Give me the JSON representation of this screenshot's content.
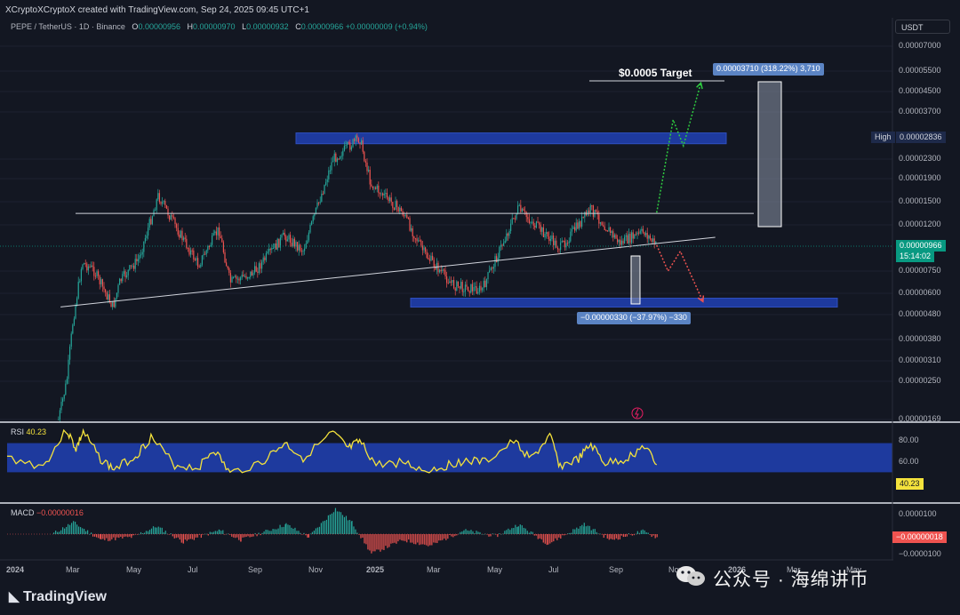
{
  "header": {
    "credit": "XCryptoXCryptoX created with TradingView.com, Sep 24, 2025 09:45 UTC+1",
    "symbol": "PEPE / TetherUS · 1D · Binance",
    "ohlc": [
      {
        "k": "O",
        "v": "0.00000956"
      },
      {
        "k": "H",
        "v": "0.00000970"
      },
      {
        "k": "L",
        "v": "0.00000932"
      },
      {
        "k": "C",
        "v": "0.00000966"
      }
    ],
    "change": "+0.00000009 (+0.94%)",
    "currency": "USDT"
  },
  "colors": {
    "background": "#131722",
    "up": "#26a69a",
    "down": "#ef5350",
    "zone": "#1e3a9e",
    "rsi_line": "#f4e23c",
    "projection_up": "#2ecc40",
    "projection_down": "#ef5350"
  },
  "price_axis": {
    "ticks": [
      "0.00007000",
      "0.00005500",
      "0.00004500",
      "0.00003700",
      "0.00002300",
      "0.00001900",
      "0.00001500",
      "0.00001200",
      "0.00000750",
      "0.00000600",
      "0.00000480",
      "0.00000380",
      "0.00000310",
      "0.00000250",
      "0.00000169"
    ],
    "high_label": "High",
    "high_value": "0.00002836",
    "last_value": "0.00000966",
    "countdown": "15:14:02"
  },
  "annotations": {
    "target_text": "$0.0005 Target",
    "measure_up": "0.00003710 (318.22%) 3,710",
    "measure_down": "−0.00000330 (−37.97%) −330"
  },
  "rsi": {
    "label": "RSI",
    "value": "40.23",
    "ticks": [
      "80.00",
      "60.00"
    ],
    "value_tag": "40.23"
  },
  "macd": {
    "label": "MACD",
    "value": "−0.00000016",
    "ticks": [
      "0.0000100",
      "−0.0000100"
    ],
    "value_tag": "−0.00000018"
  },
  "time_axis": [
    "2024",
    "Mar",
    "May",
    "Jul",
    "Sep",
    "Nov",
    "2025",
    "Mar",
    "May",
    "Jul",
    "Sep",
    "Nov",
    "2026",
    "Mar",
    "May"
  ],
  "footer": {
    "brand": "TradingView"
  },
  "watermark": {
    "text": "公众号 · 海绵讲币"
  },
  "chart_data": {
    "type": "candlestick",
    "title": "PEPE / TetherUS · 1D · Binance",
    "x_range": [
      "2024-01",
      "2026-05"
    ],
    "y_scale": "log",
    "ylim": [
      1.69e-06,
      7e-06
    ],
    "close_series": [
      {
        "x": "2024-02-20",
        "y": 1.2e-06
      },
      {
        "x": "2024-02-28",
        "y": 2.5e-06
      },
      {
        "x": "2024-03-05",
        "y": 4.5e-06
      },
      {
        "x": "2024-03-14",
        "y": 8.2e-06
      },
      {
        "x": "2024-03-25",
        "y": 7.6e-06
      },
      {
        "x": "2024-04-13",
        "y": 5.2e-06
      },
      {
        "x": "2024-04-20",
        "y": 6.8e-06
      },
      {
        "x": "2024-05-08",
        "y": 8.5e-06
      },
      {
        "x": "2024-05-27",
        "y": 1.6e-05
      },
      {
        "x": "2024-06-12",
        "y": 1.2e-05
      },
      {
        "x": "2024-07-05",
        "y": 8e-06
      },
      {
        "x": "2024-07-25",
        "y": 1.15e-05
      },
      {
        "x": "2024-08-05",
        "y": 6.7e-06
      },
      {
        "x": "2024-08-28",
        "y": 7.4e-06
      },
      {
        "x": "2024-09-27",
        "y": 1.08e-05
      },
      {
        "x": "2024-10-15",
        "y": 9.3e-06
      },
      {
        "x": "2024-11-13",
        "y": 2.3e-05
      },
      {
        "x": "2024-12-09",
        "y": 2.8e-05
      },
      {
        "x": "2024-12-20",
        "y": 1.8e-05
      },
      {
        "x": "2025-01-20",
        "y": 1.35e-05
      },
      {
        "x": "2025-02-10",
        "y": 9e-06
      },
      {
        "x": "2025-03-10",
        "y": 6.5e-06
      },
      {
        "x": "2025-04-07",
        "y": 6.2e-06
      },
      {
        "x": "2025-05-12",
        "y": 1.4e-05
      },
      {
        "x": "2025-06-22",
        "y": 9.5e-06
      },
      {
        "x": "2025-07-22",
        "y": 1.4e-05
      },
      {
        "x": "2025-08-19",
        "y": 1e-05
      },
      {
        "x": "2025-09-12",
        "y": 1.12e-05
      },
      {
        "x": "2025-09-24",
        "y": 9.66e-06
      }
    ],
    "zones": [
      {
        "from": 2.65e-05,
        "to": 2.95e-05
      },
      {
        "from": 5.2e-06,
        "to": 5.7e-06
      }
    ],
    "horizontal_line": 1.34e-05,
    "trendline": [
      {
        "x": "2024-02-22",
        "y": 5.2e-06
      },
      {
        "x": "2025-11-20",
        "y": 1.06e-05
      }
    ],
    "target_line": 5e-05,
    "projection_up": [
      {
        "x": "2025-09-24",
        "y": 1.35e-05
      },
      {
        "x": "2025-10-10",
        "y": 3.4e-05
      },
      {
        "x": "2025-10-20",
        "y": 2.6e-05
      },
      {
        "x": "2025-11-06",
        "y": 4.9e-05
      }
    ],
    "projection_down": [
      {
        "x": "2025-09-24",
        "y": 9.8e-06
      },
      {
        "x": "2025-10-05",
        "y": 7.5e-06
      },
      {
        "x": "2025-10-17",
        "y": 9.2e-06
      },
      {
        "x": "2025-11-08",
        "y": 5.5e-06
      }
    ],
    "rsi": {
      "range": [
        0,
        100
      ],
      "band": [
        30,
        70
      ],
      "series": [
        {
          "x": "2024-01-01",
          "y": 50
        },
        {
          "x": "2024-02-05",
          "y": 38
        },
        {
          "x": "2024-02-28",
          "y": 88
        },
        {
          "x": "2024-03-08",
          "y": 62
        },
        {
          "x": "2024-03-15",
          "y": 85
        },
        {
          "x": "2024-04-01",
          "y": 48
        },
        {
          "x": "2024-04-14",
          "y": 34
        },
        {
          "x": "2024-05-05",
          "y": 52
        },
        {
          "x": "2024-05-20",
          "y": 78
        },
        {
          "x": "2024-06-12",
          "y": 40
        },
        {
          "x": "2024-07-05",
          "y": 36
        },
        {
          "x": "2024-07-20",
          "y": 62
        },
        {
          "x": "2024-08-05",
          "y": 28
        },
        {
          "x": "2024-09-05",
          "y": 44
        },
        {
          "x": "2024-09-27",
          "y": 70
        },
        {
          "x": "2024-10-15",
          "y": 50
        },
        {
          "x": "2024-11-13",
          "y": 84
        },
        {
          "x": "2024-11-28",
          "y": 62
        },
        {
          "x": "2024-12-09",
          "y": 72
        },
        {
          "x": "2024-12-25",
          "y": 40
        },
        {
          "x": "2025-01-20",
          "y": 44
        },
        {
          "x": "2025-02-10",
          "y": 32
        },
        {
          "x": "2025-03-01",
          "y": 38
        },
        {
          "x": "2025-03-20",
          "y": 46
        },
        {
          "x": "2025-04-10",
          "y": 44
        },
        {
          "x": "2025-05-08",
          "y": 72
        },
        {
          "x": "2025-05-25",
          "y": 48
        },
        {
          "x": "2025-06-12",
          "y": 80
        },
        {
          "x": "2025-06-22",
          "y": 38
        },
        {
          "x": "2025-07-10",
          "y": 48
        },
        {
          "x": "2025-07-22",
          "y": 68
        },
        {
          "x": "2025-08-05",
          "y": 42
        },
        {
          "x": "2025-08-25",
          "y": 48
        },
        {
          "x": "2025-09-12",
          "y": 66
        },
        {
          "x": "2025-09-24",
          "y": 40.23
        }
      ]
    },
    "macd": {
      "range": [
        -1e-06,
        1e-06
      ],
      "histogram": [
        {
          "x": "2024-02-15",
          "y": 5e-08
        },
        {
          "x": "2024-03-05",
          "y": 6e-07
        },
        {
          "x": "2024-04-01",
          "y": -3e-07
        },
        {
          "x": "2024-05-01",
          "y": -1.5e-07
        },
        {
          "x": "2024-05-25",
          "y": 4e-07
        },
        {
          "x": "2024-06-20",
          "y": -4e-07
        },
        {
          "x": "2024-07-25",
          "y": 2e-07
        },
        {
          "x": "2024-08-15",
          "y": -3e-07
        },
        {
          "x": "2024-09-28",
          "y": 5e-07
        },
        {
          "x": "2024-10-20",
          "y": -1.5e-07
        },
        {
          "x": "2024-11-15",
          "y": 1.3e-06
        },
        {
          "x": "2024-12-01",
          "y": 6e-07
        },
        {
          "x": "2024-12-20",
          "y": -1e-06
        },
        {
          "x": "2025-01-20",
          "y": -3e-07
        },
        {
          "x": "2025-02-15",
          "y": -6e-07
        },
        {
          "x": "2025-03-20",
          "y": 2e-07
        },
        {
          "x": "2025-04-20",
          "y": -1e-07
        },
        {
          "x": "2025-05-12",
          "y": 5e-07
        },
        {
          "x": "2025-06-10",
          "y": -5e-07
        },
        {
          "x": "2025-07-15",
          "y": 5e-07
        },
        {
          "x": "2025-08-10",
          "y": -3e-07
        },
        {
          "x": "2025-09-10",
          "y": 1.5e-07
        },
        {
          "x": "2025-09-24",
          "y": -1.8e-07
        }
      ]
    }
  }
}
